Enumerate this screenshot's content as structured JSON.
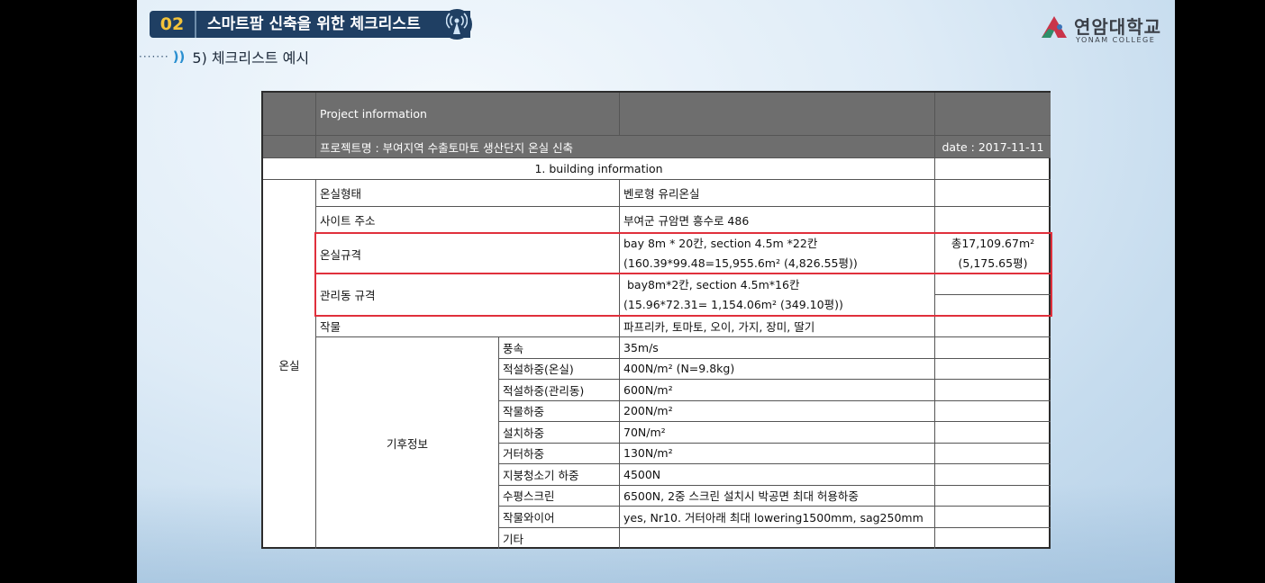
{
  "header": {
    "number": "02",
    "title": "스마트팜 신축을 위한 체크리스트"
  },
  "subtitle": {
    "dots": "·······",
    "wave": "))",
    "text": "5) 체크리스트 예시"
  },
  "logo": {
    "korean": "연암대학교",
    "english": "YONAM COLLEGE"
  },
  "colors": {
    "header_bg": "#1f3f63",
    "header_number": "#f3c33a",
    "table_header_bg": "#6e6e6e",
    "highlight_border": "#e0303c"
  },
  "table": {
    "project_information": "Project information",
    "project_name": "프로젝트명 : 부여지역 수출토마토 생산단지 온실 신축",
    "date": "date : 2017-11-11",
    "section": "1. building information",
    "category": "온실",
    "rows": {
      "type_label": "온실형태",
      "type_value": "벤로형 유리온실",
      "site_label": "사이트 주소",
      "site_value": "부여군 규암면 흥수로 486",
      "spec_label": "온실규격",
      "spec_line1": "bay 8m * 20칸, section 4.5m *22칸",
      "spec_line2": "(160.39*99.48=15,955.6m² (4,826.55평))",
      "total_line1": "총17,109.67m²",
      "total_line2": "(5,175.65평)",
      "mgmt_label": "관리동 규격",
      "mgmt_line1": " bay8m*2칸, section 4.5m*16칸",
      "mgmt_line2": "(15.96*72.31= 1,154.06m² (349.10평))",
      "crop_label": "작물",
      "crop_value": "파프리카, 토마토, 오이, 가지, 장미, 딸기"
    },
    "climate_label": "기후정보",
    "climate": [
      {
        "label": "풍속",
        "value": "35m/s"
      },
      {
        "label": "적설하중(온실)",
        "value": "400N/m² (N=9.8kg)"
      },
      {
        "label": "적설하중(관리동)",
        "value": "600N/m²"
      },
      {
        "label": "작물하중",
        "value": "200N/m²"
      },
      {
        "label": "설치하중",
        "value": "70N/m²"
      },
      {
        "label": "거터하중",
        "value": "130N/m²"
      },
      {
        "label": "지붕청소기 하중",
        "value": "4500N"
      },
      {
        "label": "수평스크린",
        "value": "6500N, 2중 스크린 설치시 박공면 최대 허용하중"
      },
      {
        "label": "작물와이어",
        "value": "yes, Nr10. 거터아래 최대 lowering1500mm, sag250mm"
      },
      {
        "label": "기타",
        "value": ""
      }
    ]
  }
}
